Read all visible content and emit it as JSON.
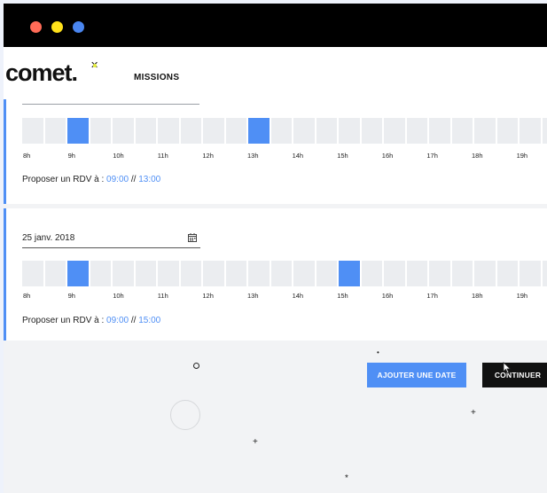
{
  "window_controls": [
    "close-dot",
    "minimize-dot",
    "maximize-dot"
  ],
  "colors": {
    "accent": "#4f8ff5",
    "dark": "#111111",
    "slot": "#ebedf0",
    "logo_spark": "#e6ef3b"
  },
  "header": {
    "logo": "comet.",
    "nav_missions": "MISSIONS"
  },
  "hours": [
    "8h",
    "9h",
    "10h",
    "11h",
    "12h",
    "13h",
    "14h",
    "15h",
    "16h",
    "17h",
    "18h",
    "19h"
  ],
  "card1": {
    "selected_slots": [
      2,
      10
    ],
    "proposer_label": "Proposer un RDV à :",
    "time1": "09:00",
    "sep": "//",
    "time2": "13:00"
  },
  "card2": {
    "date_value": "25 janv. 2018",
    "selected_slots": [
      2,
      14
    ],
    "proposer_label": "Proposer un RDV à :",
    "time1": "09:00",
    "sep": "//",
    "time2": "15:00"
  },
  "actions": {
    "add_date": "AJOUTER UNE DATE",
    "continue": "CONTINUER"
  }
}
